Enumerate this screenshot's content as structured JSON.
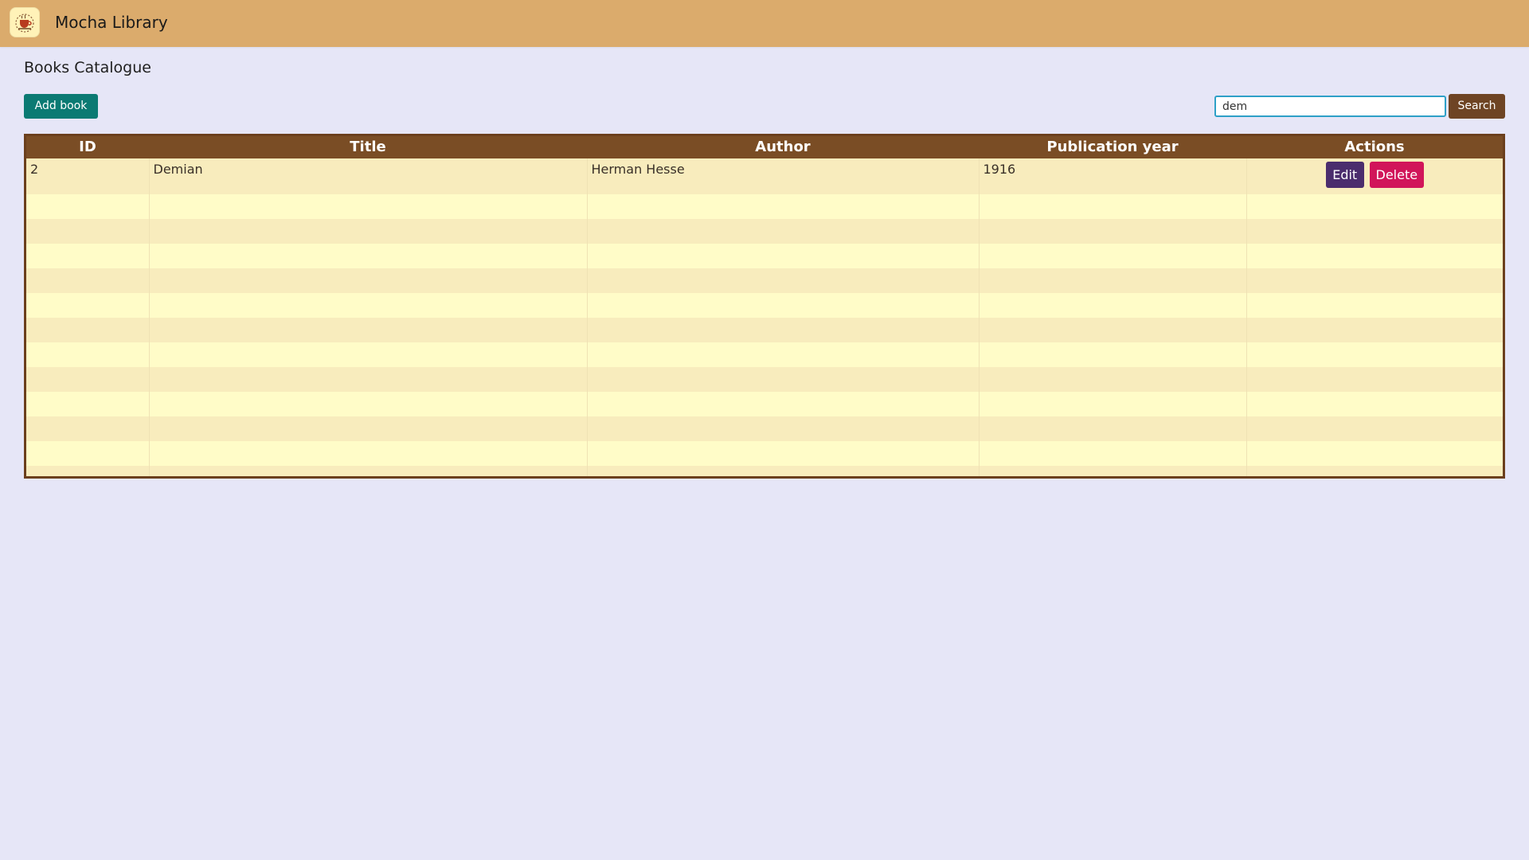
{
  "app": {
    "title": "Mocha Library"
  },
  "page": {
    "title": "Books Catalogue"
  },
  "toolbar": {
    "add_book_label": "Add book",
    "search_value": "dem",
    "search_label": "Search"
  },
  "table": {
    "headers": [
      "ID",
      "Title",
      "Author",
      "Publication year",
      "Actions"
    ],
    "rows": [
      {
        "id": "2",
        "title": "Demian",
        "author": "Herman Hesse",
        "publication_year": "1916",
        "actions": {
          "edit_label": "Edit",
          "delete_label": "Delete"
        }
      }
    ],
    "empty_rows": 12
  },
  "colors": {
    "topbar": "#dbab6c",
    "background": "#e6e6f7",
    "table_header": "#7a4d25",
    "add_button": "#0b7a73",
    "search_button": "#6e4424",
    "edit_button": "#4b2d6d",
    "delete_button": "#d1155a"
  },
  "icons": {
    "logo": "coffee-cup-logo-icon"
  }
}
